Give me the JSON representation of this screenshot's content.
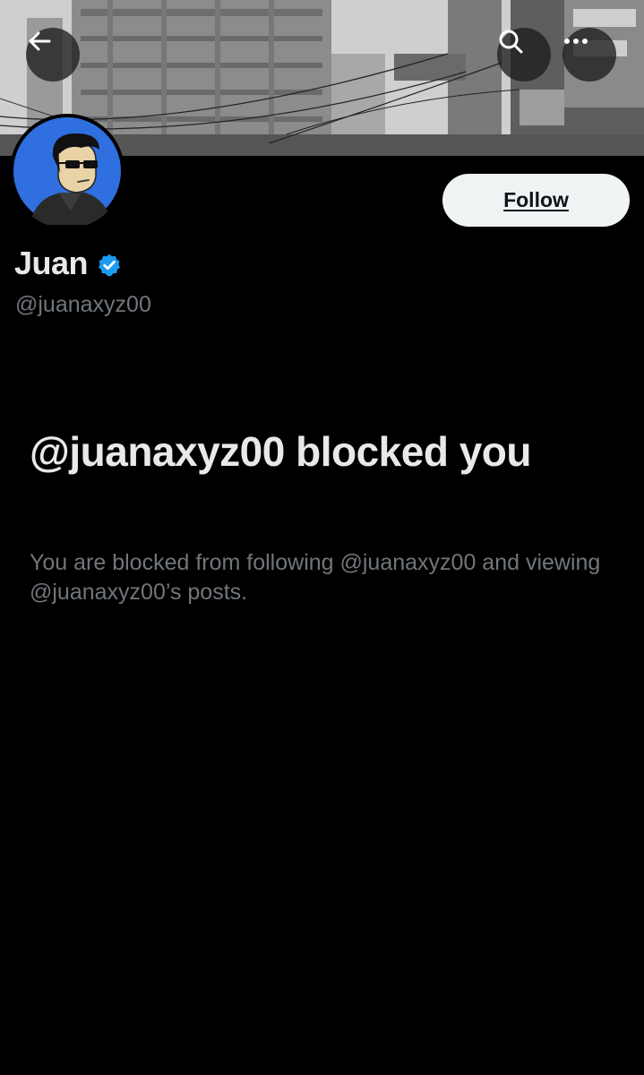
{
  "header": {
    "back_icon": "arrow-left-icon",
    "search_icon": "search-icon",
    "more_icon": "more-dots-icon"
  },
  "profile": {
    "display_name": "Juan",
    "handle": "@juanaxyz00",
    "verified": true,
    "verified_color": "#1d9bf0",
    "follow_label": "Follow"
  },
  "blocked_notice": {
    "title": "@juanaxyz00 blocked you",
    "description": "You are blocked from following @juanaxyz00 and viewing @juanaxyz00’s posts."
  },
  "colors": {
    "background": "#000000",
    "primary_text": "#e7e9ea",
    "secondary_text": "#71767b",
    "button_background": "#eff3f4",
    "avatar_background": "#2f6fe0"
  }
}
